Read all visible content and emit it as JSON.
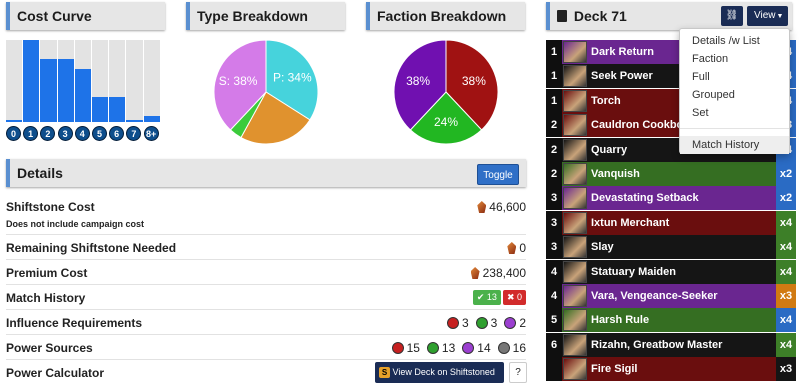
{
  "cost_curve": {
    "title": "Cost Curve",
    "labels": [
      "0",
      "1",
      "2",
      "3",
      "4",
      "5",
      "6",
      "7",
      "8+"
    ],
    "values": [
      2,
      86,
      66,
      66,
      56,
      26,
      26,
      2,
      6
    ],
    "max": 86,
    "bar_color": "#1e73e8"
  },
  "type_breakdown": {
    "title": "Type Breakdown",
    "slices": [
      {
        "label": "P: 34%",
        "value": 34,
        "color": "#46d3dc"
      },
      {
        "label": "",
        "value": 24,
        "color": "#e0922e"
      },
      {
        "label": "",
        "value": 4,
        "color": "#3ccb3c"
      },
      {
        "label": "S: 38%",
        "value": 38,
        "color": "#d47be8"
      }
    ]
  },
  "faction_breakdown": {
    "title": "Faction Breakdown",
    "slices": [
      {
        "label": "38%",
        "value": 38,
        "color": "#a01212"
      },
      {
        "label": "24%",
        "value": 24,
        "color": "#22b722"
      },
      {
        "label": "38%",
        "value": 38,
        "color": "#7010b0"
      }
    ]
  },
  "details": {
    "title": "Details",
    "toggle_label": "Toggle",
    "rows": {
      "shiftstone_cost": {
        "label": "Shiftstone Cost",
        "sub": "Does not include campaign cost",
        "value": "46,600"
      },
      "remaining": {
        "label": "Remaining Shiftstone Needed",
        "value": "0"
      },
      "premium": {
        "label": "Premium Cost",
        "value": "238,400"
      },
      "match_history": {
        "label": "Match History",
        "wins": "13",
        "losses": "0"
      },
      "influence": {
        "label": "Influence Requirements",
        "fire": "3",
        "time": "3",
        "shadow": "2"
      },
      "power": {
        "label": "Power Sources",
        "fire": "15",
        "time": "13",
        "shadow": "14",
        "common": "16"
      },
      "calculator": {
        "label": "Power Calculator",
        "button": "View Deck on Shiftstoned"
      }
    }
  },
  "deck": {
    "title": "Deck 71",
    "view_label": "View",
    "dropdown": [
      "Details /w List",
      "Faction",
      "Full",
      "Grouped",
      "Set",
      "Match History"
    ],
    "cards": [
      {
        "cost": "1",
        "name": "Dark Return",
        "qty": "x4",
        "color": "#6a2690",
        "qcolor": "#2a6bc4"
      },
      {
        "cost": "1",
        "name": "Seek Power",
        "qty": "x4",
        "color": "#151515",
        "qcolor": "#2a6bc4"
      },
      {
        "cost": "1",
        "name": "Torch",
        "qty": "x4",
        "color": "#6a0e0e",
        "qcolor": "#2a6bc4"
      },
      {
        "cost": "2",
        "name": "Cauldron Cookbook",
        "qty": "x3",
        "color": "#6a0e0e",
        "qcolor": "#2a6bc4"
      },
      {
        "cost": "2",
        "name": "Quarry",
        "qty": "x4",
        "color": "#151515",
        "qcolor": "#2a6bc4"
      },
      {
        "cost": "2",
        "name": "Vanquish",
        "qty": "x2",
        "color": "#356e22",
        "qcolor": "#2a6bc4"
      },
      {
        "cost": "3",
        "name": "Devastating Setback",
        "qty": "x2",
        "color": "#6a2690",
        "qcolor": "#2a6bc4"
      },
      {
        "cost": "3",
        "name": "Ixtun Merchant",
        "qty": "x4",
        "color": "#6a0e0e",
        "qcolor": "#3d7f28"
      },
      {
        "cost": "3",
        "name": "Slay",
        "qty": "x4",
        "color": "#151515",
        "qcolor": "#3d7f28"
      },
      {
        "cost": "4",
        "name": "Statuary Maiden",
        "qty": "x4",
        "color": "#151515",
        "qcolor": "#3d7f28"
      },
      {
        "cost": "4",
        "name": "Vara, Vengeance-Seeker",
        "qty": "x3",
        "color": "#6a2690",
        "qcolor": "#d17a12"
      },
      {
        "cost": "5",
        "name": "Harsh Rule",
        "qty": "x4",
        "color": "#356e22",
        "qcolor": "#2a6bc4"
      },
      {
        "cost": "6",
        "name": "Rizahn, Greatbow Master",
        "qty": "x4",
        "color": "#151515",
        "qcolor": "#3d7f28"
      },
      {
        "cost": "",
        "name": "Fire Sigil",
        "qty": "x3",
        "color": "#6a0e0e",
        "qcolor": "#151515"
      }
    ]
  }
}
